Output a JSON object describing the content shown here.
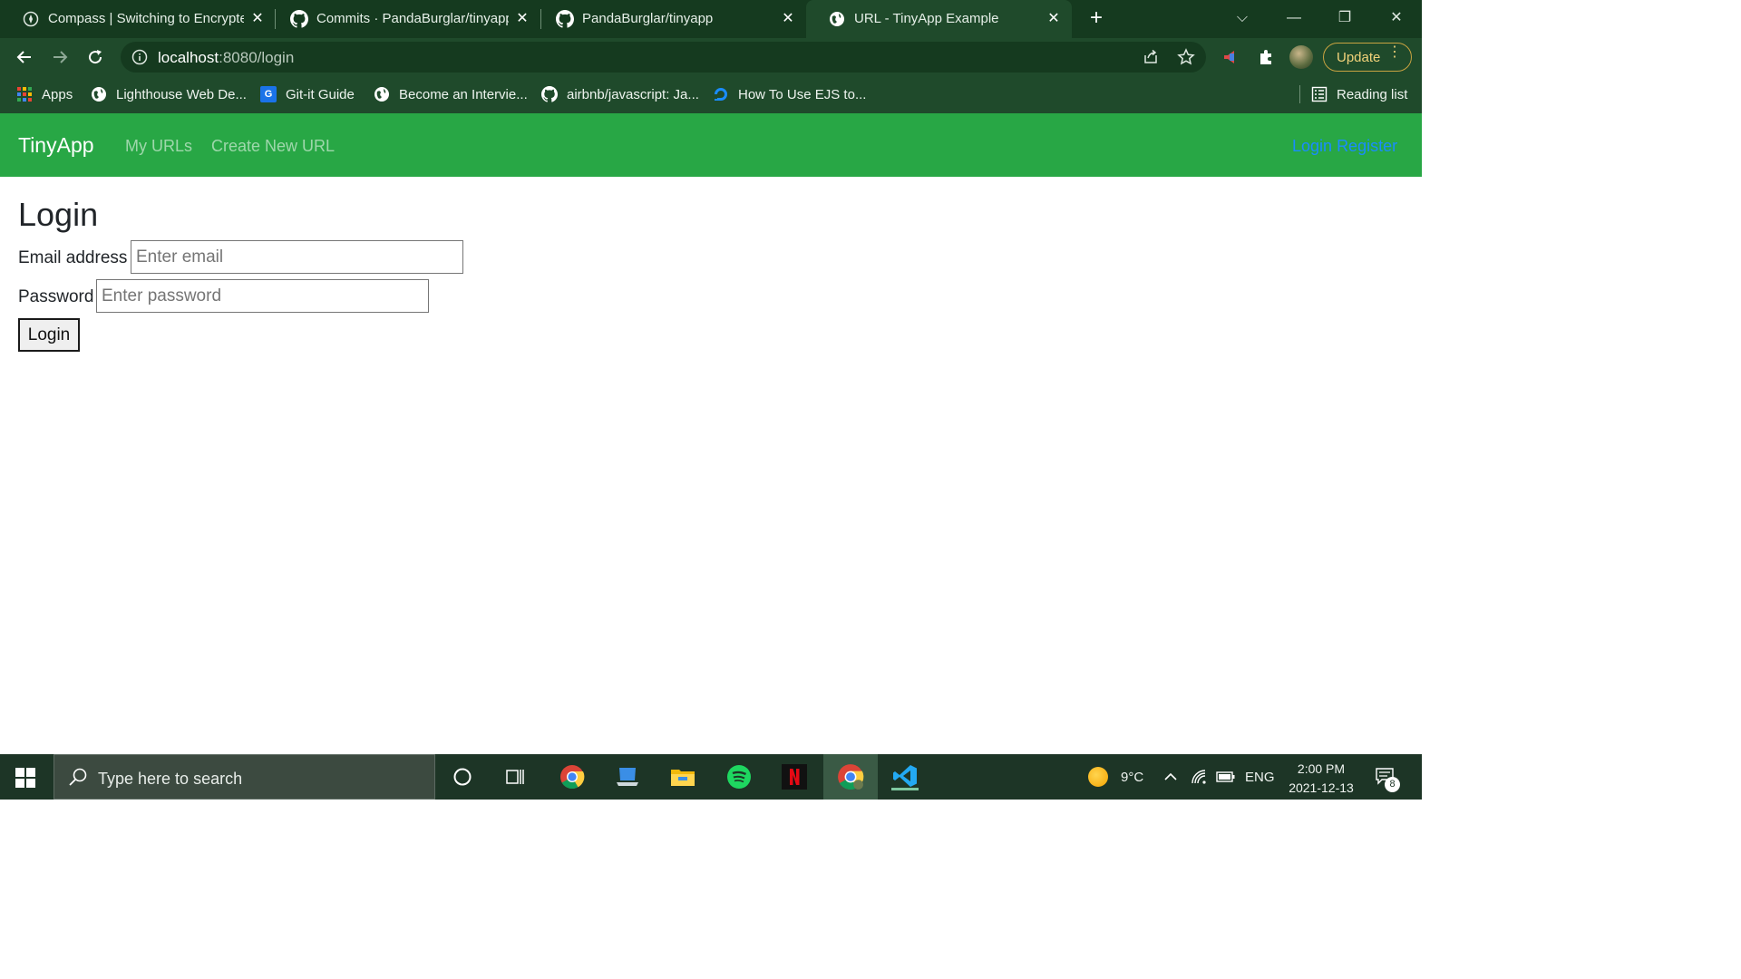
{
  "browser": {
    "tabs": [
      {
        "title": "Compass | Switching to Encrypted",
        "icon": "compass-favicon",
        "active": false
      },
      {
        "title": "Commits · PandaBurglar/tinyapp",
        "icon": "github-icon",
        "active": false
      },
      {
        "title": "PandaBurglar/tinyapp",
        "icon": "github-icon",
        "active": false
      },
      {
        "title": "URL - TinyApp Example",
        "icon": "globe-icon",
        "active": true
      }
    ],
    "address": {
      "host": "localhost",
      "rest": ":8080/login"
    },
    "update_label": "Update",
    "bookmarks": [
      {
        "label": "Apps",
        "icon": "apps-grid-icon"
      },
      {
        "label": "Lighthouse Web De...",
        "icon": "globe-icon"
      },
      {
        "label": "Git-it Guide",
        "icon": "g-favicon"
      },
      {
        "label": "Become an Intervie...",
        "icon": "globe-icon"
      },
      {
        "label": "airbnb/javascript: Ja...",
        "icon": "github-icon"
      },
      {
        "label": "How To Use EJS to...",
        "icon": "digitalocean-icon"
      }
    ],
    "reading_list": "Reading list"
  },
  "app": {
    "brand": "TinyApp",
    "nav": {
      "my_urls": "My URLs",
      "create_new": "Create New URL"
    },
    "auth": {
      "login": "Login",
      "register": "Register"
    }
  },
  "login": {
    "title": "Login",
    "email_label": "Email address",
    "email_placeholder": "Enter email",
    "password_label": "Password",
    "password_placeholder": "Enter password",
    "submit_label": "Login"
  },
  "taskbar": {
    "search_placeholder": "Type here to search",
    "weather": "9°C",
    "language": "ENG",
    "time": "2:00 PM",
    "date": "2021-12-13",
    "notification_count": "8"
  },
  "colors": {
    "navbar": "#28a745",
    "link": "#1a8cff",
    "chrome": "#1f4a2b"
  }
}
